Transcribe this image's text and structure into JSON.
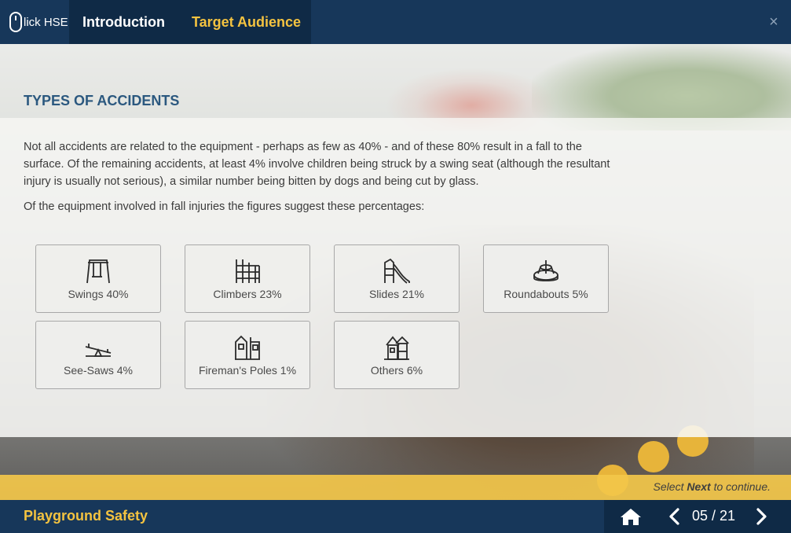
{
  "header": {
    "logo_text": "lick HSE",
    "tabs": [
      {
        "label": "Introduction"
      },
      {
        "label": "Target Audience"
      }
    ],
    "close_label": "×"
  },
  "content": {
    "title": "TYPES OF ACCIDENTS",
    "paragraph1": "Not all accidents are related to the equipment - perhaps as few as 40% - and of these 80% result in a fall to the surface. Of the remaining accidents, at least 4% involve children being struck by a swing seat (although the resultant injury is usually not serious), a similar number being bitten by dogs and being cut by glass.",
    "paragraph2": "Of the equipment involved in fall injuries the figures suggest these percentages:",
    "cards": [
      {
        "label": "Swings 40%",
        "icon": "swing-icon"
      },
      {
        "label": "Climbers 23%",
        "icon": "climber-icon"
      },
      {
        "label": "Slides 21%",
        "icon": "slide-icon"
      },
      {
        "label": "Roundabouts 5%",
        "icon": "roundabout-icon"
      },
      {
        "label": "See-Saws 4%",
        "icon": "seesaw-icon"
      },
      {
        "label": "Fireman's Poles 1%",
        "icon": "fireman-pole-icon"
      },
      {
        "label": "Others 6%",
        "icon": "playhouse-icon"
      }
    ]
  },
  "footer": {
    "hint_prefix": "Select ",
    "hint_bold": "Next",
    "hint_suffix": " to continue.",
    "course_title": "Playground Safety",
    "page_indicator": "05 / 21"
  },
  "colors": {
    "header_bg": "#17375a",
    "tab_bg": "#0f2a46",
    "accent": "#f4c340",
    "title": "#2b587f",
    "hint_strip": "#f3c74a"
  }
}
